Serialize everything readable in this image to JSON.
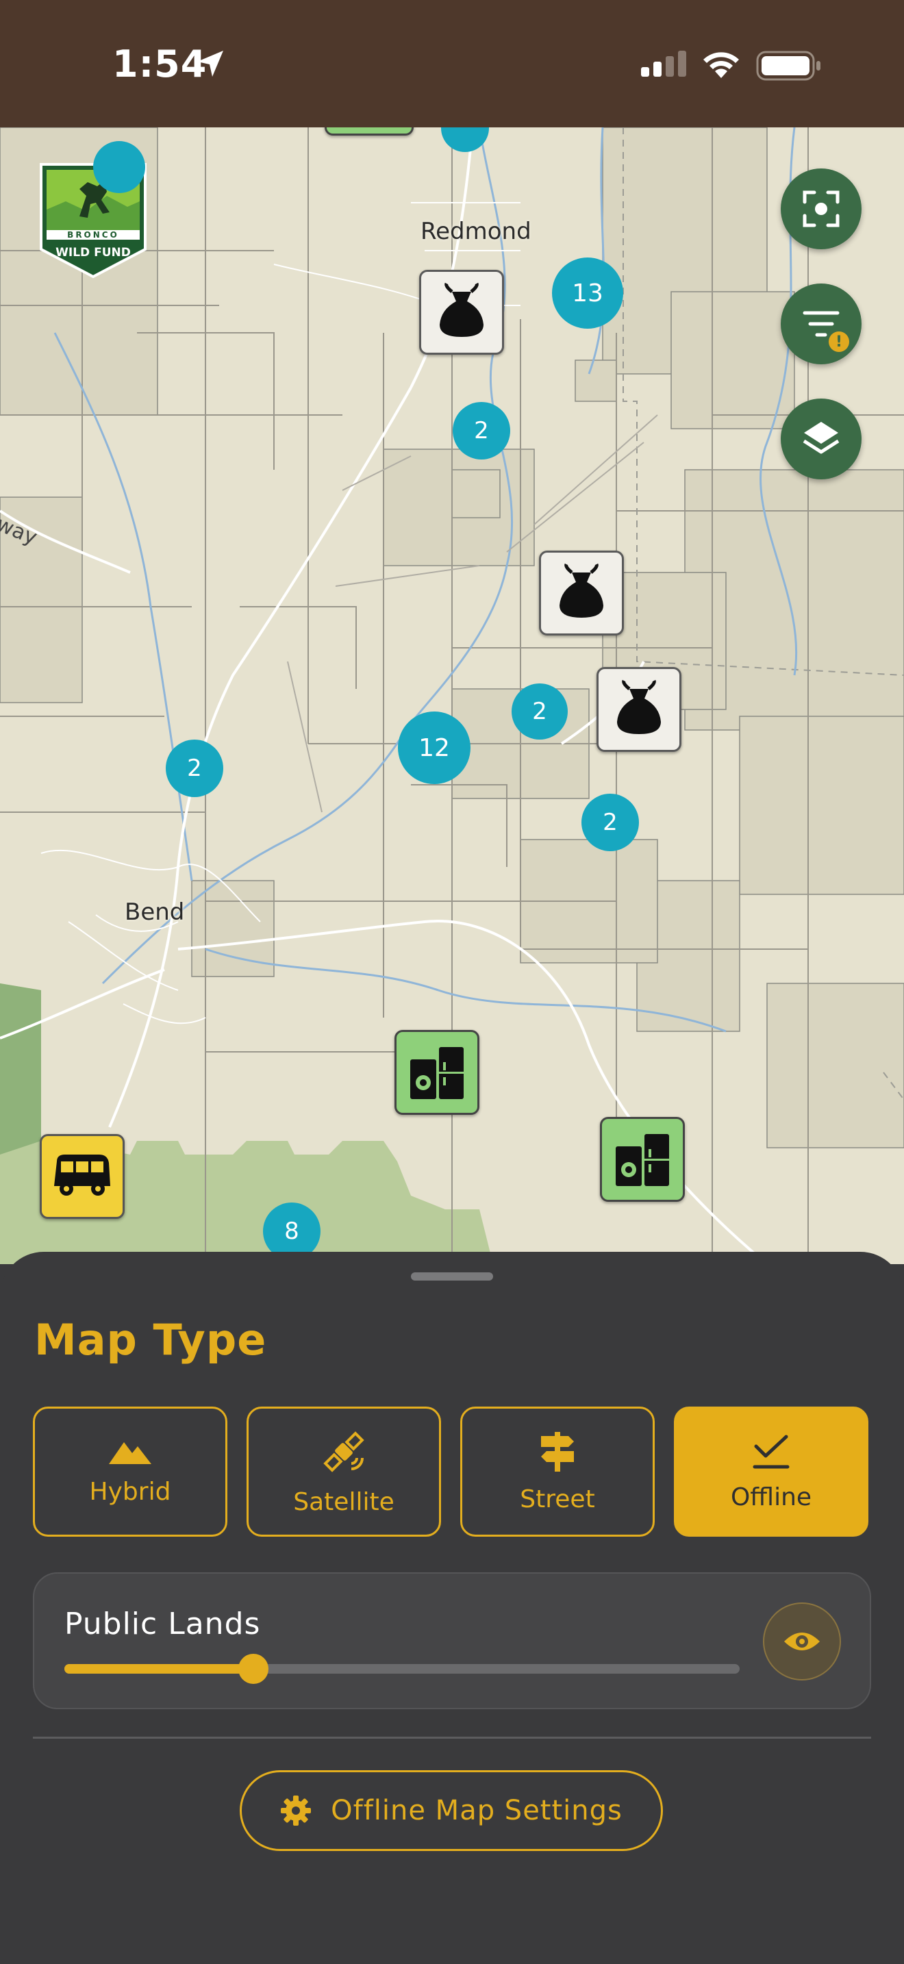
{
  "status_bar": {
    "time": "1:54",
    "icons": [
      "location-arrow-icon",
      "cellular-signal-icon",
      "wifi-icon",
      "battery-icon"
    ]
  },
  "map": {
    "logo": {
      "lines": [
        "BRONCO",
        "WILD FUND"
      ]
    },
    "town_labels": [
      "Redmond",
      "Bend"
    ],
    "road_label": "way",
    "clusters": [
      "13",
      "2",
      "2",
      "12",
      "2",
      "2",
      "8"
    ],
    "poi_icons": [
      "trash-bag-icon",
      "laundry-icon",
      "bus-icon"
    ],
    "fab_buttons": [
      "recenter-icon",
      "filter-icon",
      "layers-icon"
    ],
    "filter_badge": "!"
  },
  "sheet": {
    "title": "Map Type",
    "types": [
      {
        "label": "Hybrid",
        "icon": "mountain-icon",
        "selected": false
      },
      {
        "label": "Satellite",
        "icon": "satellite-icon",
        "selected": false
      },
      {
        "label": "Street",
        "icon": "signpost-icon",
        "selected": false
      },
      {
        "label": "Offline",
        "icon": "checkmark-icon",
        "selected": true
      }
    ],
    "layer": {
      "label": "Public Lands",
      "opacity": 0.28,
      "visibility_icon": "eye-icon"
    },
    "settings_button": {
      "label": "Offline Map Settings",
      "icon": "gear-icon"
    }
  },
  "colors": {
    "accent": "#e4ae1e",
    "status_bar_bg": "#4e382b",
    "sheet_bg": "#3a3a3c",
    "cluster": "#17a7c0",
    "fab": "#3b6b46",
    "map_bg": "#e6e2cf"
  }
}
